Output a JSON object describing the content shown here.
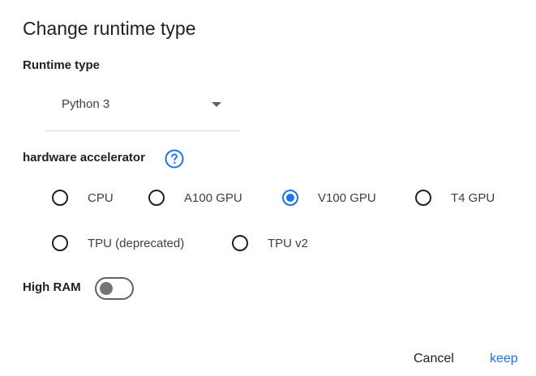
{
  "dialog": {
    "title": "Change runtime type"
  },
  "runtime": {
    "label": "Runtime type",
    "selected_value": "Python 3"
  },
  "hardware": {
    "label": "hardware accelerator",
    "help_icon": "help-circle-icon",
    "options": [
      {
        "label": "CPU",
        "checked": false
      },
      {
        "label": "A100 GPU",
        "checked": false
      },
      {
        "label": "V100 GPU",
        "checked": true
      },
      {
        "label": "T4 GPU",
        "checked": false
      },
      {
        "label": "TPU (deprecated)",
        "checked": false
      },
      {
        "label": "TPU v2",
        "checked": false
      }
    ]
  },
  "high_ram": {
    "label": "High RAM",
    "enabled": false
  },
  "actions": {
    "cancel_label": "Cancel",
    "keep_label": "keep"
  },
  "colors": {
    "accent": "#1a73e8",
    "text": "#202124",
    "divider": "#dadce0"
  }
}
